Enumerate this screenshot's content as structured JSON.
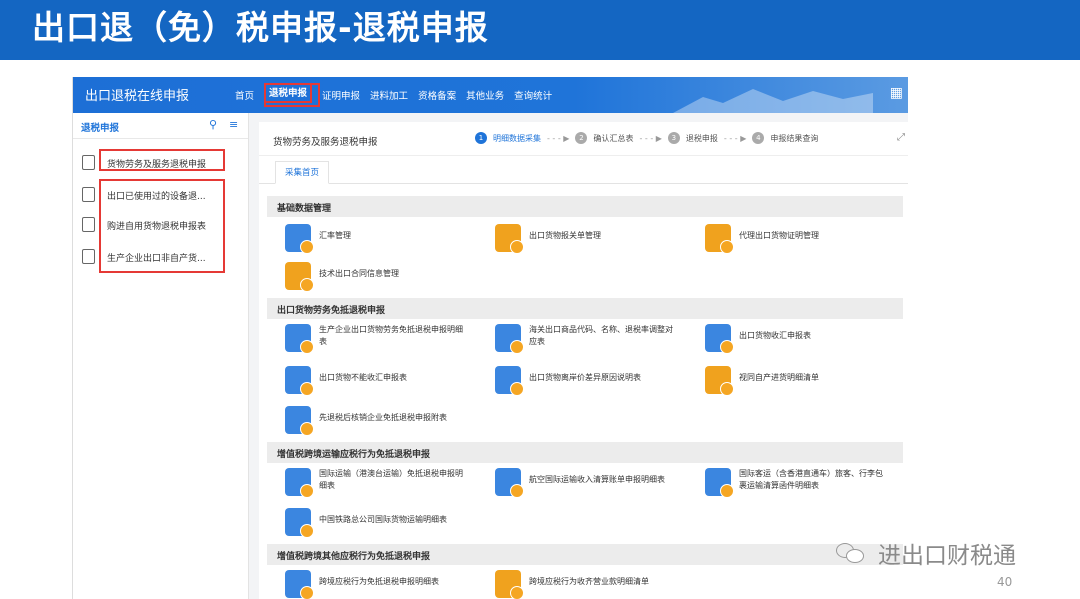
{
  "slide": {
    "title": "出口退（免）税申报-退税申报",
    "page_number": "40",
    "watermark": "进出口财税通"
  },
  "app": {
    "brand": "出口退税在线申报",
    "nav": [
      "首页",
      "退税申报",
      "证明申报",
      "进料加工",
      "资格备案",
      "其他业务",
      "查询统计"
    ],
    "nav_active": "退税申报"
  },
  "sidebar": {
    "title": "退税申报",
    "items": [
      {
        "label": "货物劳务及服务退税申报",
        "icon": "shield-doc-icon"
      },
      {
        "label": "出口已使用过的设备退...",
        "icon": "doc-icon"
      },
      {
        "label": "购进自用货物退税申报表",
        "icon": "doc-icon"
      },
      {
        "label": "生产企业出口非自产货...",
        "icon": "house-icon"
      }
    ]
  },
  "main": {
    "title": "货物劳务及服务退税申报",
    "steps": [
      {
        "num": "1",
        "label": "明细数据采集"
      },
      {
        "num": "2",
        "label": "确认汇总表"
      },
      {
        "num": "3",
        "label": "退税申报"
      },
      {
        "num": "4",
        "label": "申报结果查询"
      }
    ],
    "tab": "采集首页",
    "sections": [
      {
        "title": "基础数据管理",
        "cards": [
          "汇率管理",
          "出口货物报关单管理",
          "代理出口货物证明管理",
          "技术出口合同信息管理"
        ]
      },
      {
        "title": "出口货物劳务免抵退税申报",
        "cards": [
          "生产企业出口货物劳务免抵退税申报明细表",
          "海关出口商品代码、名称、退税率调整对应表",
          "出口货物收汇申报表",
          "出口货物不能收汇申报表",
          "出口货物离岸价差异原因说明表",
          "视同自产进货明细清单",
          "先退税后核销企业免抵退税申报附表"
        ]
      },
      {
        "title": "增值税跨境运输应税行为免抵退税申报",
        "cards": [
          "国际运输（港澳台运输）免抵退税申报明细表",
          "航空国际运输收入清算账单申报明细表",
          "国际客运（含香港直通车）旅客、行李包裹运输清算函件明细表",
          "中国铁路总公司国际货物运输明细表"
        ]
      },
      {
        "title": "增值税跨境其他应税行为免抵退税申报",
        "cards": [
          "跨境应税行为免抵退税申报明细表",
          "跨境应税行为收齐营业款明细清单"
        ]
      }
    ]
  },
  "colors": {
    "header": "#1466c2",
    "app_bar": "#1f74d9",
    "highlight": "#e53935",
    "icon_blue": "#3b86e0",
    "icon_orange": "#f0a21e"
  }
}
